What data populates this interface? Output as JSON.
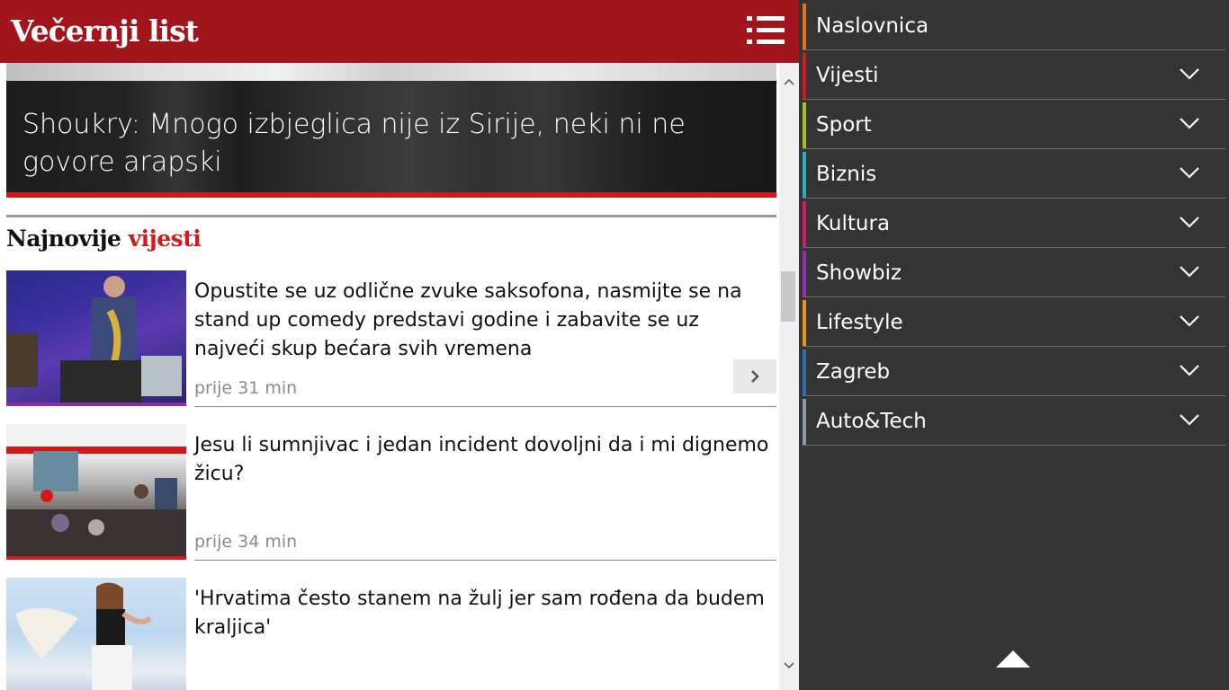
{
  "header": {
    "logo": "Večernji list",
    "menu_icon": "hamburger-list-icon",
    "background_color": "#a3151c"
  },
  "hero": {
    "title": "Shoukry: Mnogo izbjeglica nije iz Sirije, neki ni ne govore arapski",
    "accent_color": "#d21a1a"
  },
  "section": {
    "title_part1": "Najnovije",
    "title_part2": "vijesti",
    "accent_color": "#d21a1a"
  },
  "news": [
    {
      "headline": "Opustite se uz odlične zvuke saksofona, nasmijte se na stand up comedy predstavi godine i zabavite se uz najveći skup bećara svih vremena",
      "time": "prije 31 min",
      "strip_color": "#8a2bb0"
    },
    {
      "headline": "Jesu li sumnjivac i jedan incident dovoljni da i mi dignemo žicu?",
      "time": "prije 34 min",
      "strip_color": "#d21a1a"
    },
    {
      "headline": "'Hrvatima često stanem na žulj jer sam rođena da budem kraljica'",
      "time": "",
      "strip_color": "#d21a1a"
    }
  ],
  "carousel": {
    "next_icon": "chevron-right-icon"
  },
  "sidemenu": {
    "background_color": "#343434",
    "items": [
      {
        "label": "Naslovnica",
        "color": "#e8731c",
        "expandable": false
      },
      {
        "label": "Vijesti",
        "color": "#d21a1a",
        "expandable": true
      },
      {
        "label": "Sport",
        "color": "#a8c020",
        "expandable": true
      },
      {
        "label": "Biznis",
        "color": "#2bb0b8",
        "expandable": true
      },
      {
        "label": "Kultura",
        "color": "#d01870",
        "expandable": true
      },
      {
        "label": "Showbiz",
        "color": "#9a28b8",
        "expandable": true
      },
      {
        "label": "Lifestyle",
        "color": "#f0901c",
        "expandable": true
      },
      {
        "label": "Zagreb",
        "color": "#2a6fb0",
        "expandable": true
      },
      {
        "label": "Auto&Tech",
        "color": "#8a9aa8",
        "expandable": true
      }
    ],
    "collapse_icon": "triangle-up-icon"
  }
}
